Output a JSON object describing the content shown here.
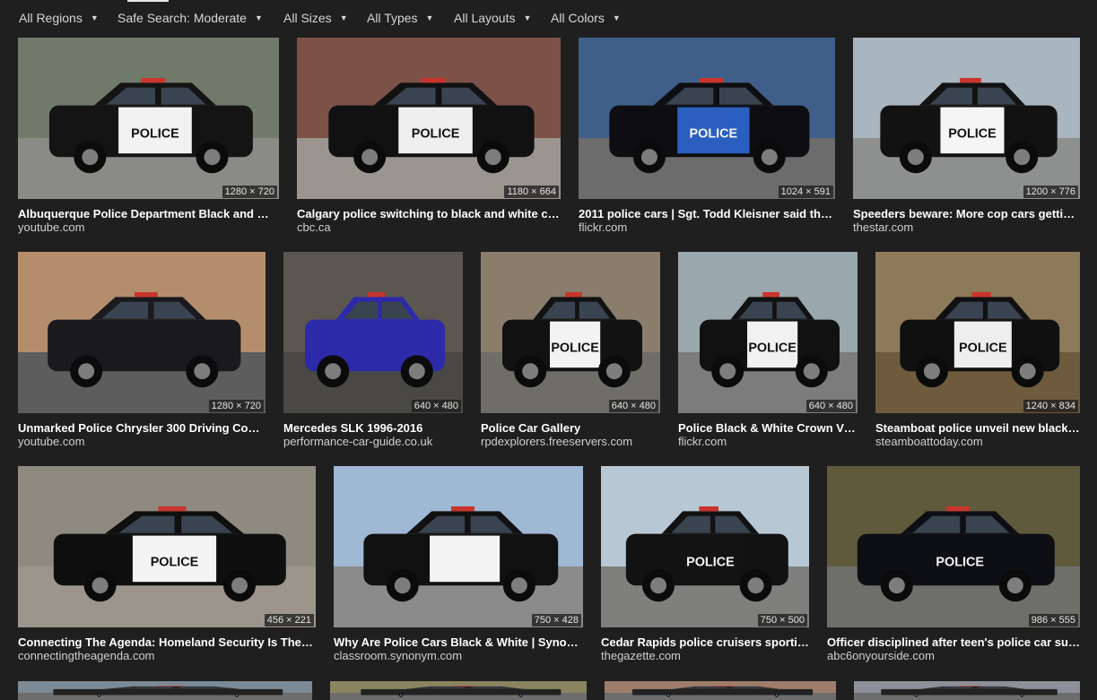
{
  "filters": [
    {
      "label": "All Regions",
      "icon": "chevron-down-icon"
    },
    {
      "label": "Safe Search: Moderate",
      "icon": "chevron-down-icon"
    },
    {
      "label": "All Sizes",
      "icon": "chevron-down-icon"
    },
    {
      "label": "All Types",
      "icon": "chevron-down-icon"
    },
    {
      "label": "All Layouts",
      "icon": "chevron-down-icon"
    },
    {
      "label": "All Colors",
      "icon": "chevron-down-icon"
    }
  ],
  "results": [
    {
      "title": "Albuquerque Police Department Black and White...",
      "source": "youtube.com",
      "dims": "1280 × 720",
      "text": "POLICE",
      "bg": "#6f7a6a",
      "ground": "#8a8a86",
      "car": "#141414",
      "door": "#f2f2f2"
    },
    {
      "title": "Calgary police switching to black and white cars...",
      "source": "cbc.ca",
      "dims": "1180 × 664",
      "text": "POLICE",
      "bg": "#7b5148",
      "ground": "#9a958e",
      "car": "#111111",
      "door": "#efefef"
    },
    {
      "title": "2011 police cars | Sgt. Todd Kleisner said the de...",
      "source": "flickr.com",
      "dims": "1024 × 591",
      "text": "POLICE",
      "bg": "#3f5f8a",
      "ground": "#6c6c6c",
      "car": "#0e0e12",
      "door": "#2b5fbf"
    },
    {
      "title": "Speeders beware: More cop cars getting ...",
      "source": "thestar.com",
      "dims": "1200 × 776",
      "text": "POLICE",
      "bg": "#a9b5bf",
      "ground": "#8e8f8f",
      "car": "#121212",
      "door": "#f5f5f5"
    },
    {
      "title": "Unmarked Police Chrysler 300 Driving Code ...",
      "source": "youtube.com",
      "dims": "1280 × 720",
      "text": "",
      "bg": "#b48e6c",
      "ground": "#5d5d5d",
      "car": "#1a1a1e",
      "door": "#1a1a1e"
    },
    {
      "title": "Mercedes SLK 1996-2016",
      "source": "performance-car-guide.co.uk",
      "dims": "640 × 480",
      "text": "",
      "bg": "#5b5750",
      "ground": "#4a4845",
      "car": "#2c2aa8",
      "door": "#2c2aa8"
    },
    {
      "title": "Police Car Gallery",
      "source": "rpdexplorers.freeservers.com",
      "dims": "640 × 480",
      "text": "POLICE",
      "bg": "#8a7d6c",
      "ground": "#6f6d68",
      "car": "#121212",
      "door": "#f3f3f3"
    },
    {
      "title": "Police Black & White Crown Vict...",
      "source": "flickr.com",
      "dims": "640 × 480",
      "text": "POLICE",
      "bg": "#9aa7ad",
      "ground": "#7c7c7c",
      "car": "#111111",
      "door": "#f1f1f1"
    },
    {
      "title": "Steamboat police unveil new black-a...",
      "source": "steamboattoday.com",
      "dims": "1240 × 834",
      "text": "POLICE",
      "bg": "#8d7a5a",
      "ground": "#6e5a3c",
      "car": "#101010",
      "door": "#eeeeee"
    },
    {
      "title": "Connecting The Agenda: Homeland Security Is The Re...",
      "source": "connectingtheagenda.com",
      "dims": "456 × 221",
      "text": "POLICE",
      "bg": "#8f8a80",
      "ground": "#9c958b",
      "car": "#0f0f0f",
      "door": "#f4f4f4"
    },
    {
      "title": "Why Are Police Cars Black & White | Synonym",
      "source": "classroom.synonym.com",
      "dims": "750 × 428",
      "text": "",
      "bg": "#9fb8d3",
      "ground": "#8b8b8b",
      "car": "#111111",
      "door": "#f4f4f4"
    },
    {
      "title": "Cedar Rapids police cruisers sporting ...",
      "source": "thegazette.com",
      "dims": "750 × 500",
      "text": "POLICE",
      "bg": "#b8c7d4",
      "ground": "#7f7f7d",
      "car": "#121212",
      "door": "#131313"
    },
    {
      "title": "Officer disciplined after teen's police car suici...",
      "source": "abc6onyourside.com",
      "dims": "986 × 555",
      "text": "POLICE",
      "bg": "#5f5a3c",
      "ground": "#6f6f6a",
      "car": "#0e0f14",
      "door": "#0e0f14"
    },
    {
      "title": "",
      "source": "",
      "dims": "",
      "text": "",
      "bg": "#7b8a94",
      "ground": "#6d6d6d",
      "car": "#222222",
      "door": "#222222"
    },
    {
      "title": "",
      "source": "",
      "dims": "",
      "text": "",
      "bg": "#8a8460",
      "ground": "#6d6d6d",
      "car": "#222222",
      "door": "#222222"
    },
    {
      "title": "",
      "source": "",
      "dims": "",
      "text": "",
      "bg": "#9e7e6a",
      "ground": "#6d6d6d",
      "car": "#222222",
      "door": "#222222"
    },
    {
      "title": "",
      "source": "",
      "dims": "",
      "text": "",
      "bg": "#8d9098",
      "ground": "#6d6d6d",
      "car": "#222222",
      "door": "#222222"
    }
  ]
}
